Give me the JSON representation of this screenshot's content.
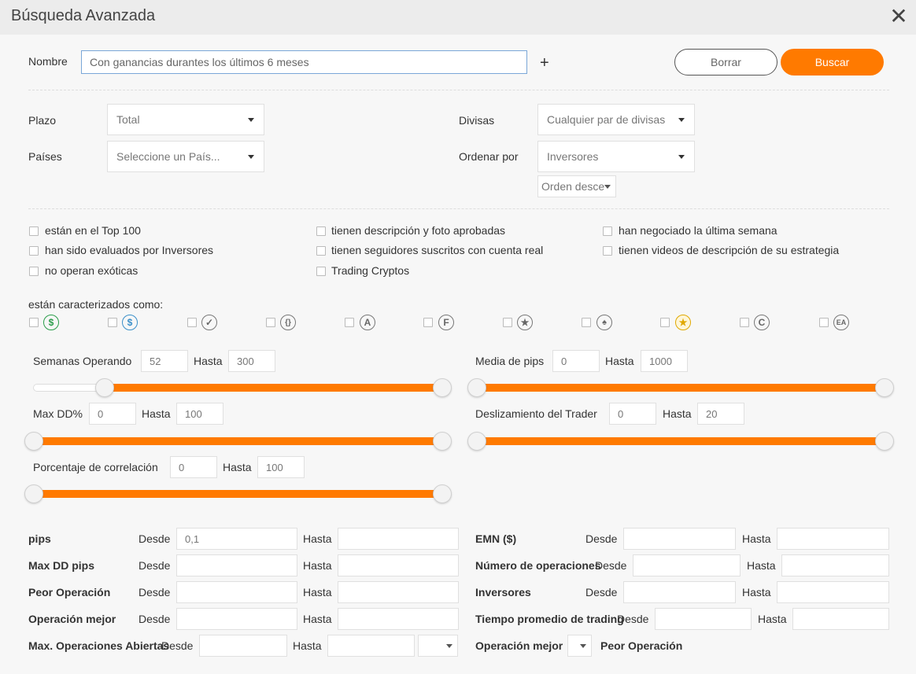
{
  "dialog": {
    "title": "Búsqueda Avanzada"
  },
  "name_row": {
    "label": "Nombre",
    "value": "Con ganancias durantes los últimos 6 meses",
    "add": "+",
    "clear_label": "Borrar",
    "search_label": "Buscar"
  },
  "filters": {
    "plazo_label": "Plazo",
    "plazo_value": "Total",
    "paises_label": "Países",
    "paises_value": "Seleccione un País...",
    "divisas_label": "Divisas",
    "divisas_value": "Cualquier par de divisas",
    "ordenar_label": "Ordenar por",
    "ordenar_value": "Inversores",
    "orden_value": "Orden desce"
  },
  "checkboxes": [
    "están en el Top 100",
    "tienen descripción y foto aprobadas",
    "han negociado la última semana",
    "han sido evaluados por Inversores",
    "tienen seguidores suscritos con cuenta real",
    "tienen videos de descripción de su estrategia",
    "no operan exóticas",
    "Trading Cryptos"
  ],
  "characterized": {
    "label": "están caracterizados como:",
    "badges": [
      {
        "icon": "dollar-green-icon",
        "glyph": "$",
        "color": "#2a9d4a"
      },
      {
        "icon": "dollar-blue-icon",
        "glyph": "$",
        "color": "#3a8fc9"
      },
      {
        "icon": "verified-check-icon",
        "glyph": "✓",
        "color": "#777777"
      },
      {
        "icon": "code-braces-icon",
        "glyph": "{}",
        "color": "#777777"
      },
      {
        "icon": "letter-a-icon",
        "glyph": "A",
        "color": "#777777"
      },
      {
        "icon": "letter-f-icon",
        "glyph": "F",
        "color": "#777777"
      },
      {
        "icon": "star-icon",
        "glyph": "★",
        "color": "#777777"
      },
      {
        "icon": "tree-icon",
        "glyph": "♠",
        "color": "#777777"
      },
      {
        "icon": "medal-icon",
        "glyph": "★",
        "color": "#e0a800"
      },
      {
        "icon": "letter-c-icon",
        "glyph": "C",
        "color": "#777777"
      },
      {
        "icon": "ea-icon",
        "glyph": "EA",
        "color": "#777777"
      }
    ]
  },
  "sliders": {
    "hasta": "Hasta",
    "semanas": {
      "label": "Semanas Operando",
      "from": "52",
      "to": "300"
    },
    "media_pips": {
      "label": "Media de pips",
      "from": "0",
      "to": "1000"
    },
    "maxdd": {
      "label": "Max DD%",
      "from": "0",
      "to": "100"
    },
    "deslizamiento": {
      "label": "Deslizamiento del Trader",
      "from": "0",
      "to": "20"
    },
    "correlacion": {
      "label": "Porcentaje de correlación",
      "from": "0",
      "to": "100"
    }
  },
  "ranges": {
    "desde": "Desde",
    "hasta": "Hasta",
    "left": [
      {
        "label": "pips",
        "from": "0,1",
        "to": ""
      },
      {
        "label": "Max DD pips",
        "from": "",
        "to": ""
      },
      {
        "label": "Peor Operación",
        "from": "",
        "to": ""
      },
      {
        "label": "Operación mejor",
        "from": "",
        "to": ""
      },
      {
        "label": "Max. Operaciones Abiertas",
        "from": "",
        "to": ""
      }
    ],
    "right": [
      {
        "label": "EMN ($)",
        "from": "",
        "to": ""
      },
      {
        "label": "Número de operaciones",
        "from": "",
        "to": ""
      },
      {
        "label": "Inversores",
        "from": "",
        "to": ""
      },
      {
        "label": "Tiempo promedio de trading",
        "from": "",
        "to": ""
      }
    ],
    "last_right_a": "Operación mejor",
    "last_right_b": "Peor Operación"
  },
  "colors": {
    "accent": "#ff7a00",
    "header_bg": "#ececec",
    "page_bg": "#f7f7f7"
  }
}
